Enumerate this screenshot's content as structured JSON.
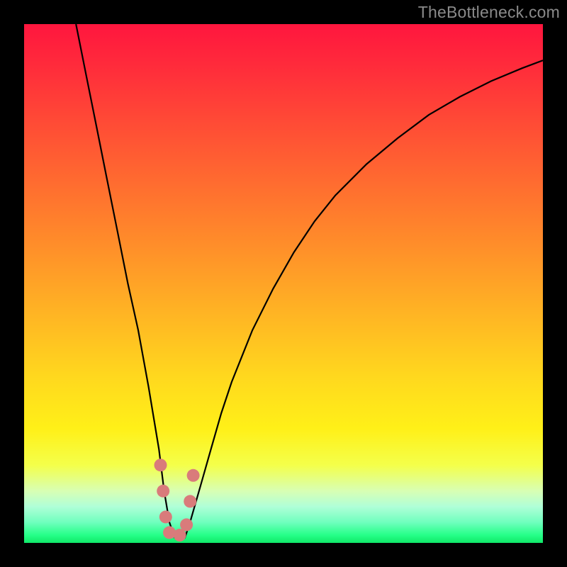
{
  "watermark": "TheBottleneck.com",
  "colors": {
    "curve": "#000000",
    "dots": "#d97b7b",
    "frame": "#000000"
  },
  "chart_data": {
    "type": "line",
    "title": "",
    "xlabel": "",
    "ylabel": "",
    "xlim": [
      0,
      100
    ],
    "ylim": [
      0,
      100
    ],
    "curve": {
      "x": [
        10,
        12,
        14,
        16,
        18,
        20,
        22,
        24,
        25,
        26,
        27,
        28,
        29,
        30,
        31,
        32,
        34,
        36,
        38,
        40,
        44,
        48,
        52,
        56,
        60,
        66,
        72,
        78,
        84,
        90,
        96,
        100
      ],
      "y": [
        100,
        90,
        80,
        70,
        60,
        50,
        41,
        30,
        24,
        18,
        10,
        4,
        1,
        0.5,
        1,
        4,
        11,
        18,
        25,
        31,
        41,
        49,
        56,
        62,
        67,
        73,
        78,
        82.5,
        86,
        89,
        91.5,
        93
      ]
    },
    "dots": [
      {
        "x": 26.3,
        "y": 15
      },
      {
        "x": 26.8,
        "y": 10
      },
      {
        "x": 27.3,
        "y": 5
      },
      {
        "x": 28.0,
        "y": 2
      },
      {
        "x": 30.0,
        "y": 1.5
      },
      {
        "x": 31.3,
        "y": 3.5
      },
      {
        "x": 32.0,
        "y": 8
      },
      {
        "x": 32.6,
        "y": 13
      }
    ],
    "dot_radius_px": 9
  }
}
